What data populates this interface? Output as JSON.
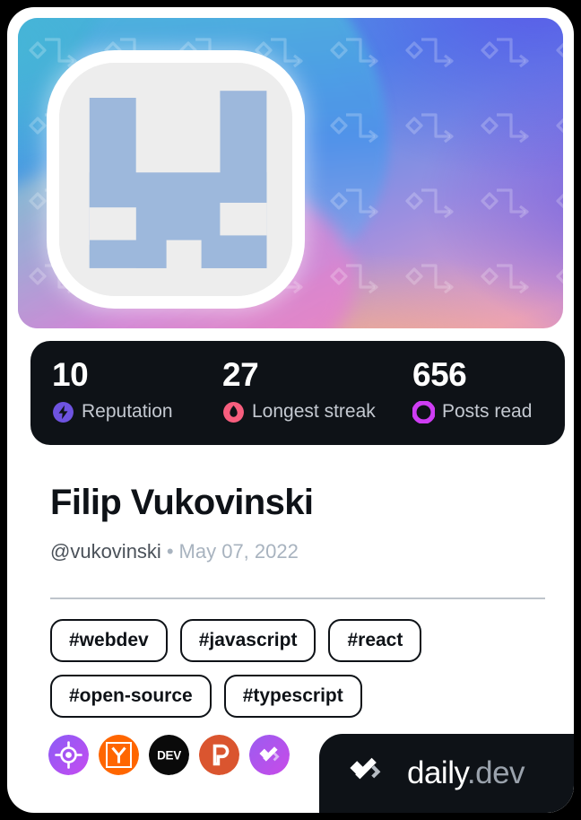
{
  "card": {
    "background_color": "#FFFFFF",
    "page_background": "#000000"
  },
  "cover": {
    "avatar_alt": "pixel-art-avatar",
    "avatar_bg_color": "#EDEDED",
    "avatar_figure_color": "#9DB8DC",
    "pattern": "daily-dev-logo-tile",
    "gradient": [
      "#4BC3D9",
      "#4D8FE8",
      "#5A5BE8",
      "#E79CC8",
      "#C37AE0"
    ]
  },
  "stats": {
    "background_color": "#0E1217",
    "items": [
      {
        "value": "10",
        "label": "Reputation",
        "icon": "bolt-icon",
        "color": "#6E53E0"
      },
      {
        "value": "27",
        "label": "Longest streak",
        "icon": "flame-icon",
        "color": "#F75E7E"
      },
      {
        "value": "656",
        "label": "Posts read",
        "icon": "ring-icon",
        "color": "#CE3DF3"
      }
    ]
  },
  "profile": {
    "name": "Filip Vukovinski",
    "handle": "@vukovinski",
    "separator": "•",
    "joined": "May 07, 2022"
  },
  "tags": [
    "#webdev",
    "#javascript",
    "#react",
    "#open-source",
    "#typescript"
  ],
  "sources": [
    {
      "name": "roadmap-source-icon",
      "title": "roadmap.sh",
      "color": "#A855F7"
    },
    {
      "name": "hackernews-source-icon",
      "title": "Hacker News",
      "color": "#FF6600"
    },
    {
      "name": "devto-source-icon",
      "title": "DEV",
      "color": "#0A0A0A"
    },
    {
      "name": "producthunt-source-icon",
      "title": "Product Hunt",
      "color": "#DA552F"
    },
    {
      "name": "dailydev-source-icon",
      "title": "daily.dev",
      "color": "#A35CE8"
    }
  ],
  "brand": {
    "name": "daily",
    "tld": ".dev",
    "logo": "daily-dev-logo"
  }
}
